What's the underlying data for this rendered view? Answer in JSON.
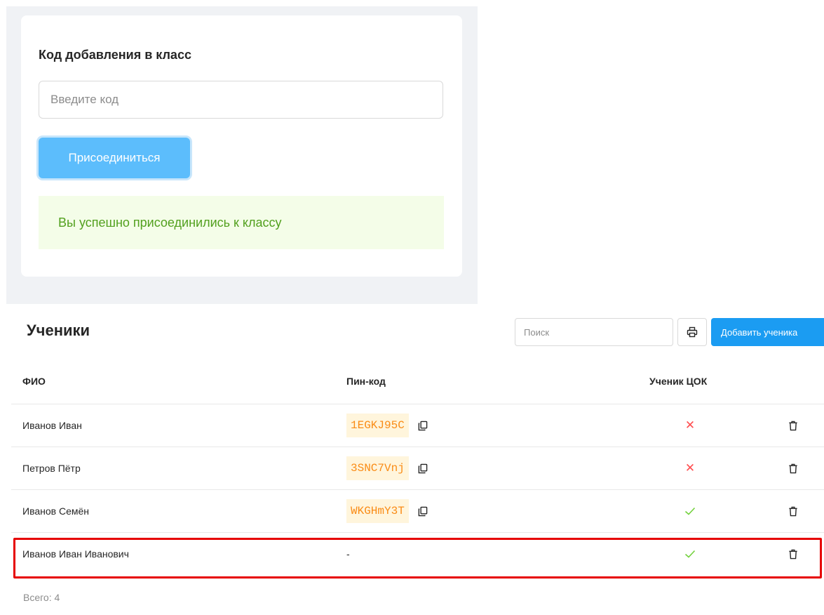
{
  "join": {
    "title": "Код добавления в класс",
    "code_placeholder": "Введите код",
    "join_button_label": "Присоединиться",
    "success_message": "Вы успешно присоединились к классу"
  },
  "students": {
    "title": "Ученики",
    "search_placeholder": "Поиск",
    "add_button_label": "Добавить ученика",
    "columns": {
      "name": "ФИО",
      "pin": "Пин-код",
      "cok": "Ученик ЦОК"
    },
    "rows": [
      {
        "name": "Иванов Иван",
        "pin": "1EGKJ95C",
        "cok": false
      },
      {
        "name": "Петров Пётр",
        "pin": "3SNC7Vnj",
        "cok": false
      },
      {
        "name": "Иванов Семён",
        "pin": "WKGHmY3T",
        "cok": true
      },
      {
        "name": "Иванов Иван Иванович",
        "pin": "-",
        "cok": true
      }
    ],
    "total": "Всего: 4"
  },
  "colors": {
    "primary": "#1b9cf2",
    "join_button": "#5cbdfc",
    "success_text": "#52a01e",
    "success_bg": "#f4fde8",
    "pin_text": "#fa8c16",
    "pin_bg": "#fff5dc",
    "cross": "#ff4d4f",
    "check": "#73d13d",
    "highlight_border": "#e60000"
  },
  "icons": {
    "print": "printer-icon",
    "copy": "copy-icon",
    "delete": "trash-icon",
    "yes": "check-icon",
    "no": "close-icon"
  }
}
